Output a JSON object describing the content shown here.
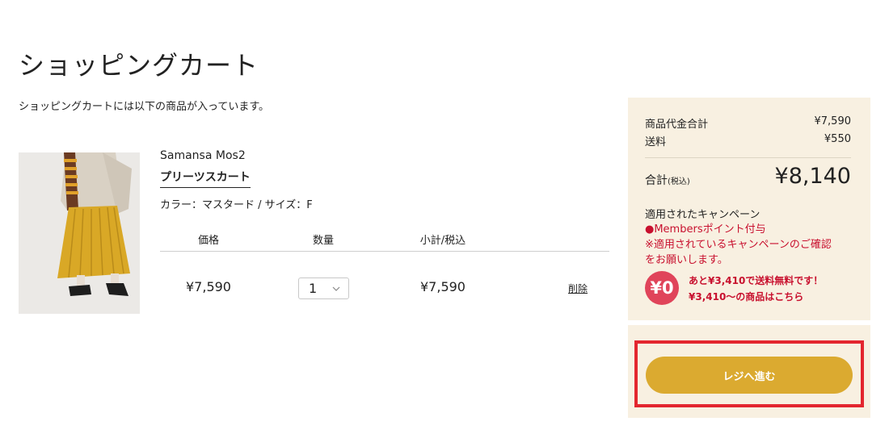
{
  "page": {
    "title": "ショッピングカート",
    "intro": "ショッピングカートには以下の商品が入っています。"
  },
  "item": {
    "brand": "Samansa Mos2",
    "name": "プリーツスカート",
    "attributes": "カラー：マスタード / サイズ：F",
    "price": "¥7,590",
    "quantity": "1",
    "subtotal": "¥7,590",
    "delete_label": "削除",
    "image_icon": "product-photo"
  },
  "table_headers": {
    "price": "価格",
    "quantity": "数量",
    "subtotal": "小計/税込"
  },
  "summary": {
    "goods_label": "商品代金合計",
    "goods_value": "¥7,590",
    "shipping_label": "送料",
    "shipping_value": "¥550",
    "total_label": "合計",
    "total_tax_note": "(税込)",
    "total_value": "¥8,140",
    "campaign_title": "適用されたキャンペーン",
    "campaign_item": "●Membersポイント付与",
    "campaign_note_1": "※適用されているキャンペーンのご確認",
    "campaign_note_2": "をお願いします。",
    "badge_text": "¥0",
    "free_ship_msg_1": "あと¥3,410で送料無料です！",
    "free_ship_msg_2": "¥3,410〜の商品はこちら"
  },
  "checkout": {
    "button_label": "レジへ進む"
  },
  "colors": {
    "accent_gold": "#dbaa30",
    "summary_bg": "#f8f0e1",
    "alert_red": "#c8102e",
    "highlight_red": "#e3262f"
  }
}
